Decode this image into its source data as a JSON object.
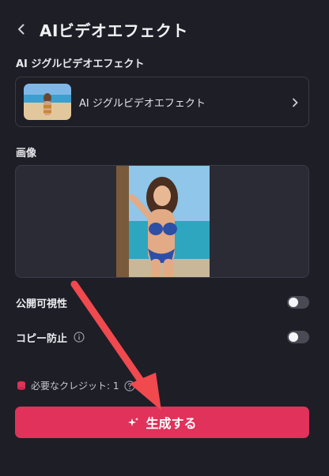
{
  "header": {
    "title": "AIビデオエフェクト",
    "back_icon": "chevron-left-icon"
  },
  "effect_section": {
    "label": "AI ジグルビデオエフェクト",
    "selected_effect": "AI ジグルビデオエフェクト",
    "chevron_icon": "chevron-right-icon"
  },
  "image_section": {
    "label": "画像"
  },
  "toggles": [
    {
      "label": "公開可視性",
      "enabled": false
    },
    {
      "label": "コピー防止",
      "enabled": false,
      "icon": "info-icon"
    }
  ],
  "credits": {
    "label": "必要なクレジット: 1",
    "icon": "coin-stack-icon",
    "help_icon": "help-icon"
  },
  "generate_button": {
    "label": "生成する",
    "icon": "sparkle-icon"
  },
  "colors": {
    "background": "#1e1e27",
    "accent": "#e0325a",
    "annotation_arrow": "#f0494e",
    "border": "#3b3b48"
  }
}
